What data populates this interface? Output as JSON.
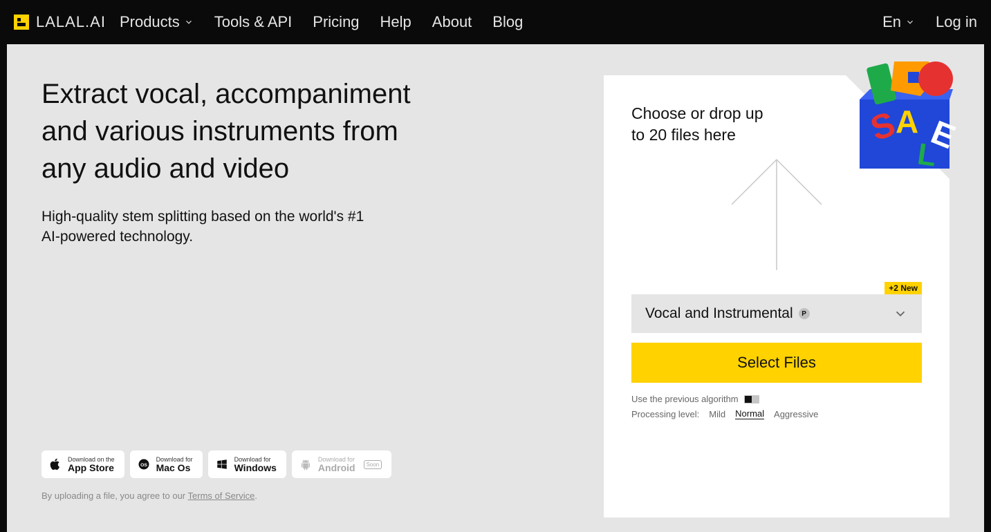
{
  "nav": {
    "logo_text": "LALAL.AI",
    "items": [
      "Products",
      "Tools & API",
      "Pricing",
      "Help",
      "About",
      "Blog"
    ],
    "lang": "En",
    "login": "Log in"
  },
  "hero": {
    "headline": "Extract vocal, accompaniment and various instruments from any audio and video",
    "subhead": "High-quality stem splitting based on the world's #1 AI-powered technology."
  },
  "downloads": {
    "appstore_top": "Download on the",
    "appstore_bottom": "App Store",
    "mac_top": "Download for",
    "mac_bottom": "Mac Os",
    "win_top": "Download for",
    "win_bottom": "Windows",
    "android_top": "Download for",
    "android_bottom": "Android",
    "soon": "Soon"
  },
  "terms": {
    "prefix": "By uploading a file, you agree to our ",
    "link": "Terms of Service",
    "suffix": "."
  },
  "card": {
    "drop_text": "Choose or drop up to 20 files here",
    "new_badge": "+2 New",
    "selector_label": "Vocal and Instrumental",
    "select_btn": "Select Files",
    "prev_algo": "Use the previous algorithm",
    "proc_label": "Processing level:",
    "levels": {
      "mild": "Mild",
      "normal": "Normal",
      "aggressive": "Aggressive"
    }
  }
}
